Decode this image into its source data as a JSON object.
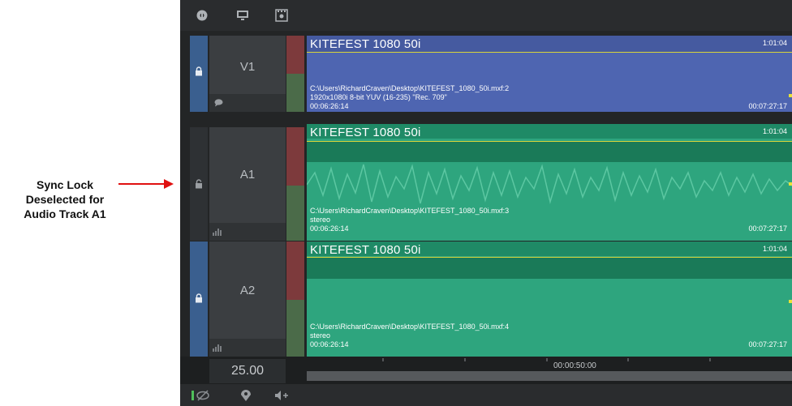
{
  "annotation": {
    "lines": [
      "Sync Lock",
      "Deselected for",
      "Audio Track A1"
    ],
    "arrow_color": "#e01010"
  },
  "toolbar": {
    "icons": [
      "eye-add-icon",
      "monitor-icon",
      "film-frame-icon"
    ]
  },
  "tracks": [
    {
      "name": "V1",
      "sync_lock": true,
      "sub_icon": "comment-icon",
      "clip": {
        "title": "KITEFEST 1080 50i",
        "duration": "1:01:04",
        "path": "C:\\Users\\RichardCraven\\Desktop\\KITEFEST_1080_50i.mxf:2",
        "format": "1920x1080i 8-bit YUV (16-235) \"Rec. 709\"",
        "tc_in": "00:06:26:14",
        "tc_out": "00:07:27:17",
        "color": "#4e65b1"
      }
    },
    {
      "name": "A1",
      "sync_lock": false,
      "sub_icon": "audio-meter-icon",
      "clip": {
        "title": "KITEFEST 1080 50i",
        "duration": "1:01:04",
        "path": "C:\\Users\\RichardCraven\\Desktop\\KITEFEST_1080_50i.mxf:3",
        "format": "stereo",
        "tc_in": "00:06:26:14",
        "tc_out": "00:07:27:17",
        "color": "#2ea57e"
      }
    },
    {
      "name": "A2",
      "sync_lock": true,
      "sub_icon": "audio-meter-icon",
      "clip": {
        "title": "KITEFEST 1080 50i",
        "duration": "1:01:04",
        "path": "C:\\Users\\RichardCraven\\Desktop\\KITEFEST_1080_50i.mxf:4",
        "format": "stereo",
        "tc_in": "00:06:26:14",
        "tc_out": "00:07:27:17",
        "color": "#2ea57e"
      }
    }
  ],
  "frame_rate": "25.00",
  "ruler": {
    "timecode": "00:00:50:00"
  },
  "bottom_toolbar": {
    "icons": [
      "hide-track-icon",
      "add-marker-icon",
      "add-audio-track-icon"
    ]
  }
}
